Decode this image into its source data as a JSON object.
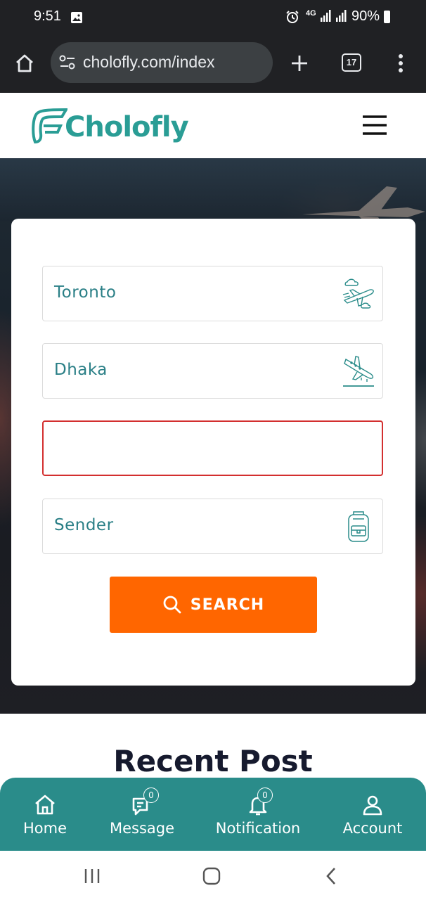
{
  "status_bar": {
    "time": "9:51",
    "network": "4G",
    "battery": "90%"
  },
  "browser": {
    "url": "cholofly.com/index",
    "tab_count": "17"
  },
  "site": {
    "brand": "Cholofly",
    "brand_color": "#2a9d95"
  },
  "form": {
    "from_value": "Toronto",
    "to_value": "Dhaka",
    "date_value": "",
    "type_value": "Sender",
    "search_label": "SEARCH",
    "accent_color": "#ff6600"
  },
  "section": {
    "recent_title": "Recent Post"
  },
  "bottom_nav": {
    "items": [
      {
        "label": "Home",
        "icon": "home-icon"
      },
      {
        "label": "Message",
        "icon": "message-icon",
        "badge": "0"
      },
      {
        "label": "Notification",
        "icon": "bell-icon",
        "badge": "0"
      },
      {
        "label": "Account",
        "icon": "account-icon"
      }
    ],
    "color": "#2a8c8a"
  }
}
